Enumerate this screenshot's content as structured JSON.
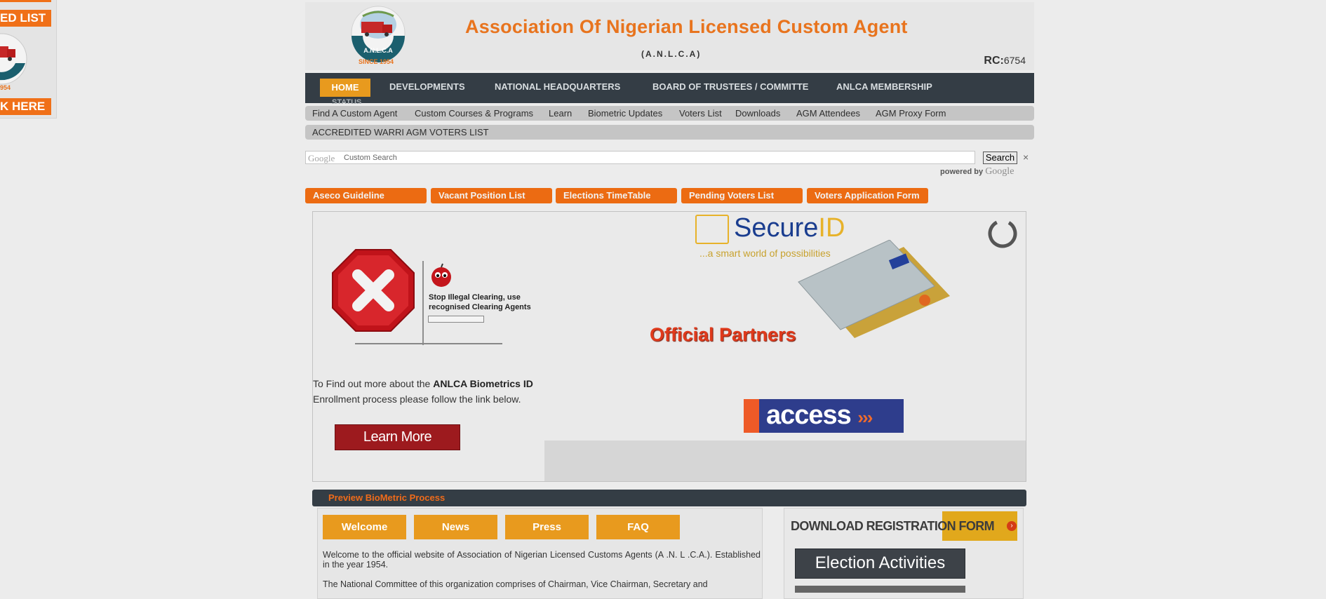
{
  "left_widget": {
    "line1": "ED LIST",
    "logo_year": "954",
    "line2": "K HERE"
  },
  "header": {
    "title": "Association Of Nigerian Licensed Custom Agent",
    "subtitle": "(A.N.L.C.A)",
    "rc_label": "RC:",
    "rc_number": "6754",
    "logo_since": "SINCE 1954",
    "logo_ring": "A.N.L.C.A"
  },
  "main_nav": {
    "home": "HOME",
    "items": [
      "DEVELOPMENTS",
      "NATIONAL HEADQUARTERS",
      "BOARD OF TRUSTEES / COMMITTE",
      "ANLCA MEMBERSHIP"
    ],
    "overflow": "STATUS"
  },
  "sub_nav": {
    "links": [
      "Find A Custom Agent",
      "Custom Courses & Programs",
      "Learn",
      "Biometric Updates",
      "Voters List",
      "Downloads",
      "AGM Attendees",
      "AGM Proxy Form"
    ],
    "second_row": "ACCREDITED WARRI AGM VOTERS LIST"
  },
  "search": {
    "google_label": "Google",
    "placeholder": "Custom Search",
    "button": "Search",
    "clear": "×",
    "powered_by": "powered by",
    "powered_google": "Google"
  },
  "quick_buttons": [
    "Aseco Guideline",
    "Vacant Position List",
    "Elections TimeTable",
    "Pending Voters List",
    "Voters Application Form"
  ],
  "slider": {
    "stop_line1": "Stop Illegal Clearing, use",
    "stop_line2": "recognised Clearing Agents",
    "text_before": "To Find out more about the ",
    "text_bold": "ANLCA Biometrics ID",
    "text_after": " Enrollment process please follow the link below.",
    "learn_more": "Learn More",
    "secure_main": "Secure",
    "secure_accent": "ID",
    "secure_tagline": "...a smart world of possibilities",
    "partners": "Official Partners",
    "access": "access",
    "access_arrows": "›››"
  },
  "preview_bar": {
    "label": "Preview BioMetric Process"
  },
  "content": {
    "tabs": [
      "Welcome",
      "News",
      "Press",
      "FAQ"
    ],
    "paragraph1": "Welcome to the official website of Association of Nigerian Licensed Customs Agents (A .N. L .C.A.). Established in the year 1954.",
    "paragraph2": "The National Committee of this organization comprises of Chairman, Vice Chairman, Secretary and"
  },
  "right_panel": {
    "download_form": "DOWNLOAD REGISTRATION FORM",
    "election": "Election Activities"
  }
}
